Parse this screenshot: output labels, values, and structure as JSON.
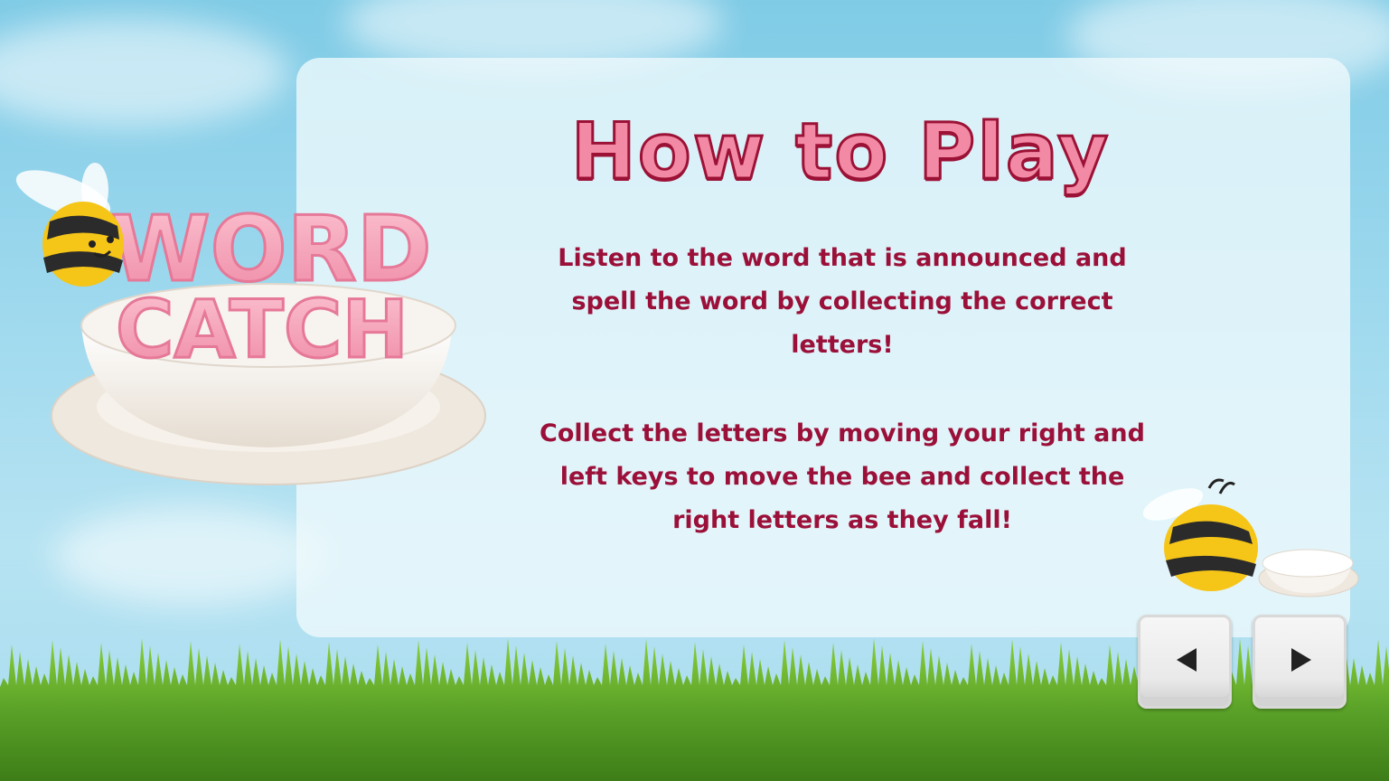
{
  "logo": {
    "line1": "WORD",
    "line2": "CATCH"
  },
  "title": "How to Play",
  "instructions": {
    "paragraph1": [
      "Listen to the word that is announced and",
      "spell the word by collecting the correct",
      "letters!"
    ],
    "paragraph2": [
      "Collect the letters by moving your right and",
      "left keys to move the bee and collect the",
      "right letters as they fall!"
    ]
  },
  "navigation": {
    "prev_icon": "triangle-left-icon",
    "next_icon": "triangle-right-icon"
  },
  "colors": {
    "title_fill": "#f38aa5",
    "title_outline": "#9c1236",
    "text": "#9b1039",
    "sky": "#9fd9ee",
    "grass": "#5aa228"
  }
}
